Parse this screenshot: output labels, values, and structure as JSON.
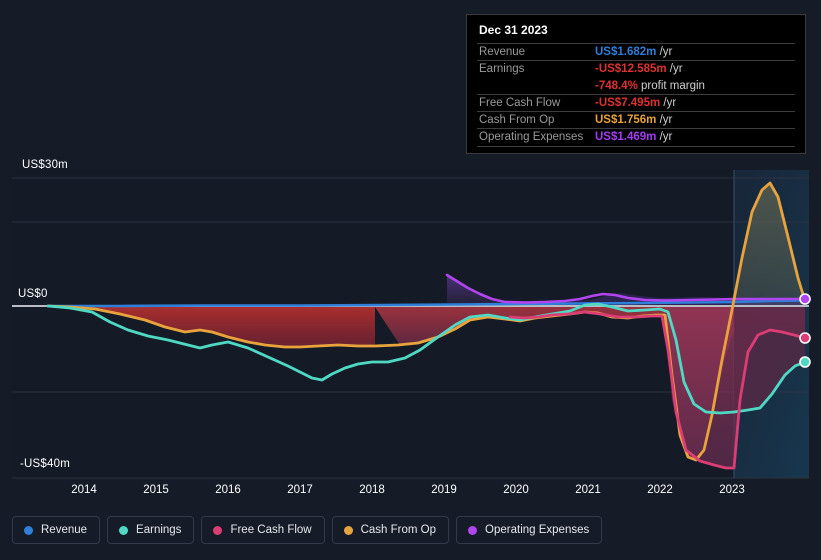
{
  "axis": {
    "y_top_label": "US$30m",
    "y_zero_label": "US$0",
    "y_bottom_label": "-US$40m",
    "x_labels": [
      "2014",
      "2015",
      "2016",
      "2017",
      "2018",
      "2019",
      "2020",
      "2021",
      "2022",
      "2023"
    ]
  },
  "tooltip": {
    "date": "Dec 31 2023",
    "rows": [
      {
        "label": "Revenue",
        "value": "US$1.682m",
        "unit": " /yr",
        "color": "#2f7ed8"
      },
      {
        "label": "Earnings",
        "value": "-US$12.585m",
        "unit": " /yr",
        "color": "#e03131"
      },
      {
        "label": "",
        "value": "-748.4%",
        "unit": " profit margin",
        "color": "#e03131"
      },
      {
        "label": "Free Cash Flow",
        "value": "-US$7.495m",
        "unit": " /yr",
        "color": "#e03131"
      },
      {
        "label": "Cash From Op",
        "value": "US$1.756m",
        "unit": " /yr",
        "color": "#e8a33d"
      },
      {
        "label": "Operating Expenses",
        "value": "US$1.469m",
        "unit": " /yr",
        "color": "#a63bf5"
      }
    ]
  },
  "legend": [
    {
      "label": "Revenue",
      "icon": "series-dot-icon",
      "color": "#2f7ed8"
    },
    {
      "label": "Earnings",
      "icon": "series-dot-icon",
      "color": "#4fd9c4"
    },
    {
      "label": "Free Cash Flow",
      "icon": "series-dot-icon",
      "color": "#db3d74"
    },
    {
      "label": "Cash From Op",
      "icon": "series-dot-icon",
      "color": "#e8a33d"
    },
    {
      "label": "Operating Expenses",
      "icon": "series-dot-icon",
      "color": "#b146f0"
    }
  ],
  "chart_data": {
    "type": "line",
    "title": "",
    "xlabel": "",
    "ylabel": "US$",
    "ylim": [
      -40,
      30
    ],
    "xlim": [
      2013.5,
      2023.9
    ],
    "grid": true,
    "legend_position": "bottom",
    "units": "US$ millions per year",
    "forecast_start_year": 2022.85,
    "annotations": [
      "Dec 31 2023 data point highlighted in tooltip"
    ],
    "series": [
      {
        "name": "Revenue",
        "color": "#2f7ed8",
        "x": [
          2013.6,
          2014,
          2015,
          2016,
          2017,
          2018,
          2019,
          2020,
          2021,
          2022,
          2022.85,
          2023.3,
          2023.85
        ],
        "values": [
          0.0,
          0.0,
          0.0,
          0.0,
          0.0,
          0.05,
          0.15,
          0.3,
          0.45,
          0.6,
          0.9,
          1.3,
          1.682
        ]
      },
      {
        "name": "Earnings",
        "color": "#4fd9c4",
        "x": [
          2013.6,
          2014,
          2014.5,
          2015,
          2015.5,
          2016,
          2016.5,
          2017,
          2017.5,
          2018,
          2018.5,
          2019,
          2019.5,
          2020,
          2020.5,
          2021,
          2021.5,
          2022,
          2022.3,
          2022.6,
          2023,
          2023.4,
          2023.85
        ],
        "values": [
          0.0,
          -0.5,
          -4.5,
          -6.5,
          -7.5,
          -6.5,
          -9.5,
          -13.5,
          -11.0,
          -10.5,
          -8.0,
          -3.0,
          -1.5,
          -1.2,
          -1.5,
          -0.6,
          -1.0,
          -1.3,
          -14.5,
          -23.5,
          -24.0,
          -18.0,
          -12.585
        ]
      },
      {
        "name": "Free Cash Flow",
        "color": "#db3d74",
        "x": [
          2019.6,
          2020,
          2020.5,
          2021,
          2021.5,
          2022,
          2022.2,
          2022.5,
          2022.85,
          2023.1,
          2023.45,
          2023.85
        ],
        "values": [
          -1.2,
          -1.3,
          -1.6,
          -1.1,
          -1.5,
          -1.4,
          -30.5,
          -34.5,
          -37.5,
          -12.0,
          -13.5,
          -7.495
        ]
      },
      {
        "name": "Cash From Op",
        "color": "#e8a33d",
        "x": [
          2013.6,
          2014,
          2014.5,
          2015,
          2015.5,
          2016,
          2016.5,
          2017,
          2017.5,
          2018,
          2018.5,
          2019,
          2019.5,
          2020,
          2020.5,
          2021,
          2021.5,
          2022,
          2022.15,
          2022.45,
          2022.75,
          2023.15,
          2023.5,
          2023.85
        ],
        "values": [
          0.0,
          -0.3,
          -1.5,
          -3.0,
          -4.8,
          -4.0,
          -6.5,
          -8.0,
          -8.5,
          -8.0,
          -5.0,
          -1.5,
          -1.3,
          -1.8,
          -1.5,
          -0.6,
          -1.6,
          -1.3,
          -21.0,
          -35.5,
          -24.0,
          12.0,
          28.5,
          1.756
        ]
      },
      {
        "name": "Operating Expenses",
        "color": "#b146f0",
        "x": [
          2019.05,
          2019.3,
          2019.6,
          2020,
          2020.5,
          2021,
          2021.3,
          2021.6,
          2022,
          2022.85,
          2023.85
        ],
        "values": [
          9.5,
          7.0,
          3.0,
          0.6,
          0.9,
          0.7,
          2.2,
          1.6,
          1.4,
          1.5,
          1.469
        ]
      }
    ]
  }
}
